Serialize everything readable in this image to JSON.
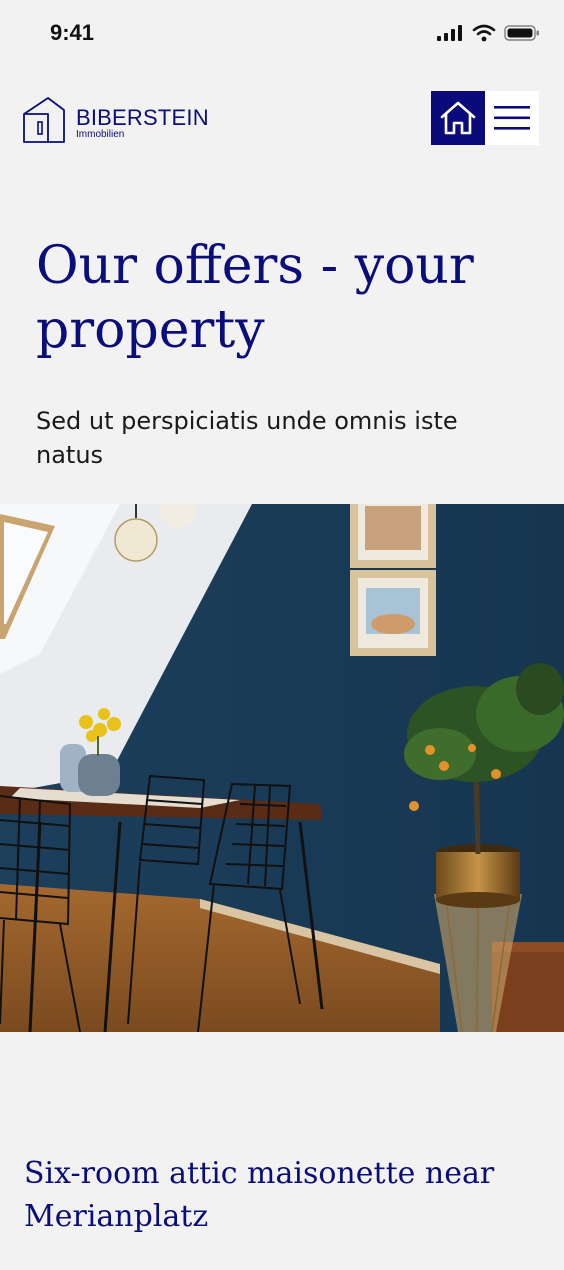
{
  "status_bar": {
    "time": "9:41",
    "icons": [
      "cellular-signal-icon",
      "wifi-icon",
      "battery-icon"
    ]
  },
  "header": {
    "brand_name": "BIBERSTEIN",
    "brand_sub": "Immobilien",
    "logo_icon": "house-outline-icon",
    "home_icon": "home-icon",
    "menu_icon": "hamburger-menu-icon"
  },
  "colors": {
    "brand": "#0b0a7a",
    "background": "#f2f2f2",
    "text": "#1a1a1a"
  },
  "hero": {
    "title": "Our offers - your property",
    "subtitle": "Sed ut perspiciatis unde omnis iste natus"
  },
  "listing": {
    "title": "Six-room attic maisonette near Merianplatz"
  }
}
